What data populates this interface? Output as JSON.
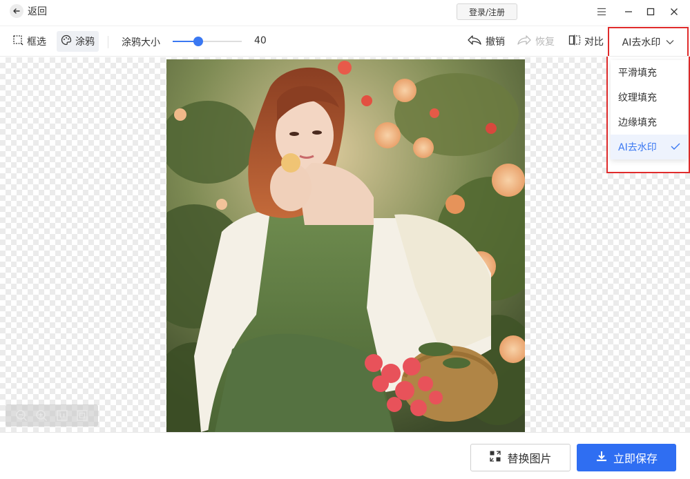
{
  "titlebar": {
    "back_label": "返回",
    "login_label": "登录/注册",
    "menu_icon": "menu-icon",
    "minimize_icon": "minimize-icon",
    "maximize_icon": "maximize-icon",
    "close_icon": "close-icon"
  },
  "toolbar": {
    "select_label": "框选",
    "brush_label": "涂鸦",
    "brush_size_label": "涂鸦大小",
    "brush_size_value": "40",
    "brush_size_fraction": 0.37,
    "undo_label": "撤销",
    "redo_label": "恢复",
    "compare_label": "对比",
    "mode_selected": "AI去水印"
  },
  "dropdown": {
    "items": [
      {
        "label": "平滑填充"
      },
      {
        "label": "纹理填充"
      },
      {
        "label": "边缘填充"
      },
      {
        "label": "AI去水印"
      }
    ],
    "selected_index": 3
  },
  "footer": {
    "replace_label": "替换图片",
    "save_label": "立即保存"
  },
  "colors": {
    "accent": "#2f6ef2",
    "highlight_border": "#e02b2b"
  }
}
